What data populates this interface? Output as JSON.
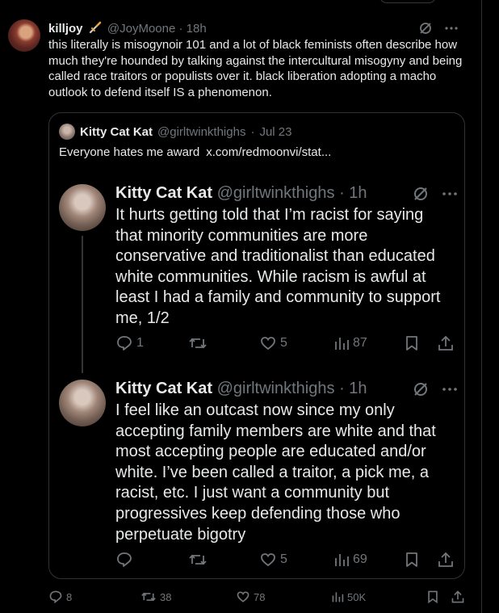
{
  "main": {
    "display_name": "killjoy",
    "handle": "@JoyMoone",
    "time": "18h",
    "text": "this literally is misogynoir 101 and a lot of black feminists often describe how much they're hounded by talking against the intercultural misogyny and being called race traitors or populists over it. black liberation adopting a macho outlook to defend itself IS a phenomenon.",
    "stats": {
      "replies": "8",
      "reposts": "38",
      "likes": "78",
      "views": "50K"
    }
  },
  "quote": {
    "display_name": "Kitty Cat Kat",
    "handle": "@girltwinkthighs",
    "time": "Jul 23",
    "text": "Everyone hates me award",
    "link": "x.com/redmoonvi/stat..."
  },
  "thread": [
    {
      "display_name": "Kitty Cat Kat",
      "handle": "@girltwinkthighs",
      "time": "1h",
      "text": "It hurts getting told that I’m racist for saying that minority communities are more conservative and traditionalist than educated white communities. While racism is awful at least I had a family and community to support me, 1/2",
      "stats": {
        "replies": "1",
        "reposts": "",
        "likes": "5",
        "views": "87"
      }
    },
    {
      "display_name": "Kitty Cat Kat",
      "handle": "@girltwinkthighs",
      "time": "1h",
      "text": "I feel like an outcast now since my only accepting family members are white and that most accepting people are educated and/or white. I’ve been called a traitor, a pick me, a racist, etc. I just want a community but progressives keep defending those who perpetuate bigotry",
      "stats": {
        "replies": "",
        "reposts": "",
        "likes": "5",
        "views": "69"
      }
    }
  ],
  "separators": {
    "dot": "·"
  },
  "colors": {
    "background": "#000000",
    "text": "#e7e9ea",
    "muted": "#71767b",
    "border": "#2f3336"
  }
}
